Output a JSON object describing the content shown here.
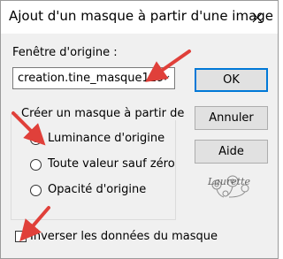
{
  "window": {
    "title": "Ajout d'un masque à partir d'une image"
  },
  "source": {
    "label": "Fenêtre d'origine :",
    "selected": "creation.tine_masque129"
  },
  "buttons": {
    "ok": "OK",
    "cancel": "Annuler",
    "help": "Aide"
  },
  "mask_group": {
    "label": "Créer un masque à partir de",
    "options": [
      {
        "label": "Luminance d'origine",
        "checked": true
      },
      {
        "label": "Toute valeur sauf zéro",
        "checked": false
      },
      {
        "label": "Opacité d'origine",
        "checked": false
      }
    ]
  },
  "invert": {
    "label": "Inverser les données du masque",
    "checked": false
  },
  "watermark": {
    "text": "Laurette"
  },
  "colors": {
    "annotation_arrow": "#e0403a",
    "default_button_border": "#0078d7"
  },
  "icons": [
    "close-icon",
    "chevron-down-icon",
    "arrow-annotation-icon",
    "flower-watermark-icon"
  ]
}
